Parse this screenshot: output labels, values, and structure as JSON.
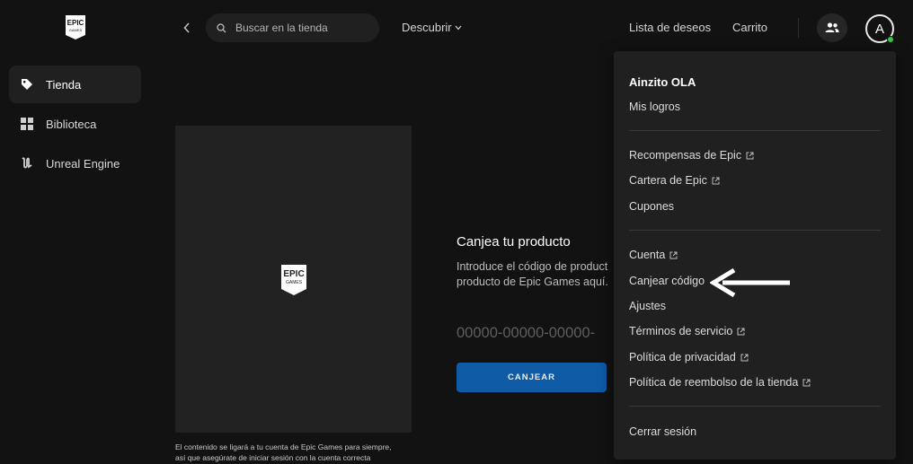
{
  "sidebar": {
    "logo_text": "EPIC GAMES",
    "items": [
      {
        "label": "Tienda",
        "icon": "tag-icon",
        "active": true
      },
      {
        "label": "Biblioteca",
        "icon": "grid-icon",
        "active": false
      },
      {
        "label": "Unreal Engine",
        "icon": "unreal-icon",
        "active": false
      }
    ]
  },
  "topbar": {
    "search_placeholder": "Buscar en la tienda",
    "discover_label": "Descubrir",
    "wishlist_label": "Lista de deseos",
    "cart_label": "Carrito",
    "avatar_initial": "A"
  },
  "main": {
    "card_logo_text": "EPIC GAMES",
    "redeem_title": "Canjea tu producto",
    "redeem_description_line1": "Introduce el código de product",
    "redeem_description_line2": "producto de Epic Games aquí.",
    "code_placeholder": "00000-00000-00000-",
    "redeem_button": "CANJEAR",
    "disclaimer_line1": "El contenido se ligará a tu cuenta de Epic Games para siempre,",
    "disclaimer_line2": "así que asegúrate de iniciar sesión con la cuenta correcta"
  },
  "menu": {
    "username": "Ainzito OLA",
    "achievements": "Mis logros",
    "epic_rewards": "Recompensas de Epic",
    "epic_wallet": "Cartera de Epic",
    "coupons": "Cupones",
    "account": "Cuenta",
    "redeem_code": "Canjear código",
    "settings": "Ajustes",
    "terms": "Términos de servicio",
    "privacy": "Política de privacidad",
    "refund": "Política de reembolso de la tienda",
    "sign_out": "Cerrar sesión"
  },
  "colors": {
    "background": "#121212",
    "surface": "#202020",
    "accent_button": "#0f5ba6",
    "online": "#2ecc40"
  }
}
